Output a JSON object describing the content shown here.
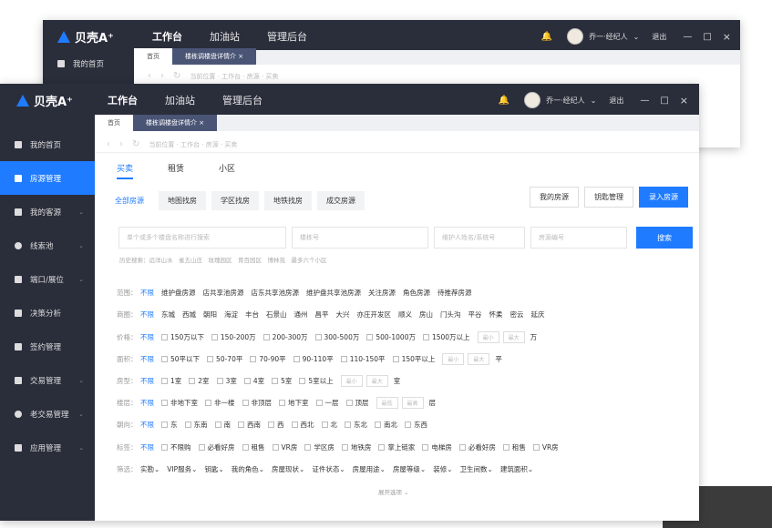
{
  "app": {
    "logo": "贝壳A⁺",
    "nav": [
      "工作台",
      "加油站",
      "管理后台"
    ],
    "user": "乔一·经纪人",
    "logout": "退出",
    "win_min": "—",
    "win_max": "□",
    "win_close": "×"
  },
  "back_window": {
    "sidebar_first": "我的首页",
    "tab_home": "首页",
    "tab_active": "楼栋调楼盘详情介 ×",
    "breadcrumb": "当前位置 · 工作台 · 房源 · 买卖"
  },
  "tabs": {
    "home": "首页",
    "active": "楼栋调楼盘详情介 ×"
  },
  "breadcrumb": "当前位置 · 工作台 · 房源 · 买卖",
  "sidebar": [
    {
      "label": "我的首页",
      "chev": ""
    },
    {
      "label": "房源管理",
      "chev": ""
    },
    {
      "label": "我的客源",
      "chev": "⌄"
    },
    {
      "label": "线索池",
      "chev": "⌄"
    },
    {
      "label": "端口/展位",
      "chev": "⌄"
    },
    {
      "label": "决策分析",
      "chev": ""
    },
    {
      "label": "签约管理",
      "chev": ""
    },
    {
      "label": "交易管理",
      "chev": "⌄"
    },
    {
      "label": "老交易管理",
      "chev": "⌄"
    },
    {
      "label": "应用管理",
      "chev": "⌄"
    }
  ],
  "subtabs": [
    "买卖",
    "租赁",
    "小区"
  ],
  "filter_tabs": [
    "全部房源",
    "地图找房",
    "学区找房",
    "地铁找房",
    "成交房源"
  ],
  "right_buttons": [
    "我的房源",
    "钥匙管理",
    "录入房源"
  ],
  "search": {
    "placeholder1": "单个或多个楼盘名称进行搜索",
    "placeholder2": "楼栋号",
    "placeholder3": "维护人姓名/系统号",
    "placeholder4": "房源编号",
    "button": "搜索"
  },
  "hints": "历史搜索：远洋山水　雀五山庄　玫瑰园区　育百园区　博林苑　最多六个小区",
  "filters": [
    {
      "label": "范围：",
      "options": [
        "不限",
        "维护盘房源",
        "店共享池房源",
        "店东共享池房源",
        "维护盘共享池房源",
        "关注房源",
        "角色房源",
        "待推荐房源"
      ],
      "checkbox": false,
      "tail": []
    },
    {
      "label": "商圈：",
      "options": [
        "不限",
        "东城",
        "西城",
        "朝阳",
        "海淀",
        "丰台",
        "石景山",
        "通州",
        "昌平",
        "大兴",
        "亦庄开发区",
        "顺义",
        "房山",
        "门头沟",
        "平谷",
        "怀柔",
        "密云",
        "延庆"
      ],
      "checkbox": false,
      "tail": []
    },
    {
      "label": "价格：",
      "options": [
        "不限",
        "150万以下",
        "150-200万",
        "200-300万",
        "300-500万",
        "500-1000万",
        "1500万以上"
      ],
      "checkbox": true,
      "tail": [
        "最小",
        "最大"
      ],
      "unit": "万"
    },
    {
      "label": "面积：",
      "options": [
        "不限",
        "50平以下",
        "50-70平",
        "70-90平",
        "90-110平",
        "110-150平",
        "150平以上"
      ],
      "checkbox": true,
      "tail": [
        "最小",
        "最大"
      ],
      "unit": "平"
    },
    {
      "label": "房型：",
      "options": [
        "不限",
        "1室",
        "2室",
        "3室",
        "4室",
        "5室",
        "5室以上"
      ],
      "checkbox": true,
      "tail": [
        "最小",
        "最大"
      ],
      "unit": "室"
    },
    {
      "label": "楼层：",
      "options": [
        "不限",
        "非地下室",
        "非一楼",
        "非顶层",
        "地下室",
        "一层",
        "顶层"
      ],
      "checkbox": true,
      "tail": [
        "最低",
        "最高"
      ],
      "unit": "层"
    },
    {
      "label": "朝向：",
      "options": [
        "不限",
        "东",
        "东南",
        "南",
        "西南",
        "西",
        "西北",
        "北",
        "东北",
        "南北",
        "东西"
      ],
      "checkbox": true,
      "tail": []
    },
    {
      "label": "标签：",
      "options": [
        "不限",
        "不限购",
        "必看好房",
        "租售",
        "VR房",
        "学区房",
        "地铁房",
        "掌上链家",
        "电梯房",
        "必看好房",
        "租售",
        "VR房"
      ],
      "checkbox": true,
      "tail": []
    },
    {
      "label": "筛选：",
      "options": [
        "实勘⌄",
        "VIP服务⌄",
        "钥匙⌄",
        "我的角色⌄",
        "房屋现状⌄",
        "证件状态⌄",
        "房屋用途⌄",
        "房屋等级⌄",
        "装修⌄",
        "卫生间数⌄",
        "建筑面积⌄"
      ],
      "checkbox": false,
      "tail": []
    }
  ],
  "more": "展开选项 ⌄"
}
